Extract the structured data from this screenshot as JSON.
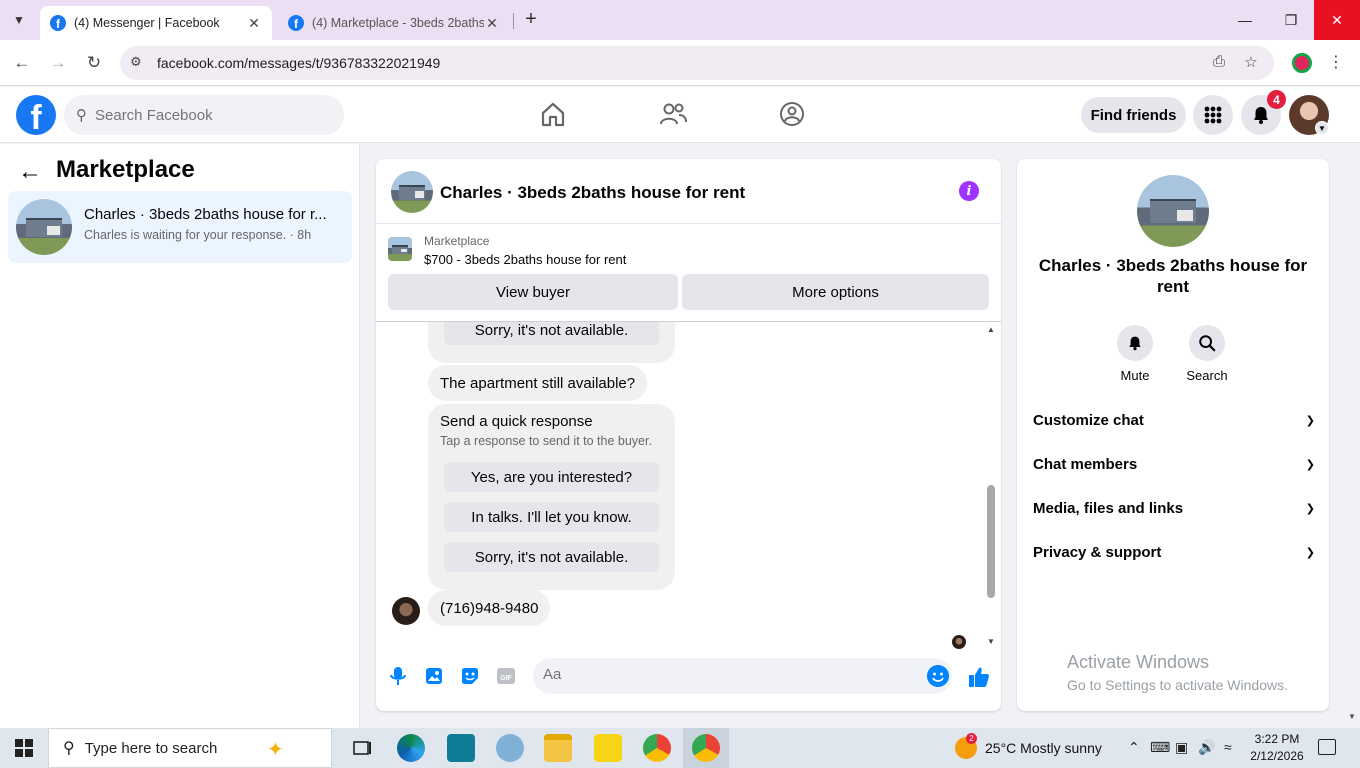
{
  "browser": {
    "tabs": [
      {
        "title": "(4) Messenger | Facebook",
        "active": true
      },
      {
        "title": "(4) Marketplace - 3beds 2baths",
        "active": false
      }
    ],
    "url": "facebook.com/messages/t/936783322021949"
  },
  "header": {
    "search_placeholder": "Search Facebook",
    "find_friends": "Find friends",
    "notification_count": "4"
  },
  "left_panel": {
    "title": "Marketplace",
    "conversations": [
      {
        "name": "Charles · 3beds 2baths house for r...",
        "preview": "Charles is waiting for your response. · 8h"
      }
    ]
  },
  "chat": {
    "title": "Charles · 3beds 2baths house for rent",
    "marketplace_label": "Marketplace",
    "listing": "$700 - 3beds 2baths house for rent",
    "view_buyer": "View buyer",
    "more_options": "More options",
    "messages": {
      "top_partial_reply": "Sorry, it's not available.",
      "buyer_question": "The apartment still available?",
      "quick_response_title": "Send a quick response",
      "quick_response_sub": "Tap a response to send it to the buyer.",
      "quick_replies": [
        "Yes, are you interested?",
        "In talks. I'll let you know.",
        "Sorry, it's not available."
      ],
      "phone": "(716)948-9480"
    },
    "composer_placeholder": "Aa",
    "accent_color": "#0084ff"
  },
  "right_panel": {
    "name": "Charles · 3beds 2baths house for rent",
    "actions": [
      "Mute",
      "Search"
    ],
    "sections": [
      "Customize chat",
      "Chat members",
      "Media, files and links",
      "Privacy & support"
    ]
  },
  "watermark": {
    "line1": "Activate Windows",
    "line2": "Go to Settings to activate Windows."
  },
  "taskbar": {
    "search_placeholder": "Type here to search",
    "weather": "25°C  Mostly sunny",
    "weather_badge": "2",
    "time": "3:22 PM",
    "date": "2/12/2026"
  }
}
